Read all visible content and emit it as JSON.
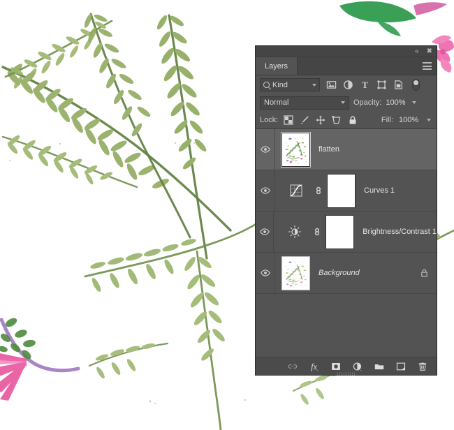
{
  "app": {
    "panel_title": "Layers"
  },
  "titlebar": {
    "collapse_icon": "double-chevron-left-icon",
    "close_icon": "close-icon",
    "menu_icon": "panel-menu-icon"
  },
  "filter": {
    "kind_label": "Kind",
    "search_icon": "search-icon",
    "dropdown_icon": "chevron-down-icon",
    "icons": [
      {
        "name": "filter-pixel-icon",
        "title": "Filter for pixel layers"
      },
      {
        "name": "filter-adjustment-icon",
        "title": "Filter for adjustment layers"
      },
      {
        "name": "filter-type-icon",
        "title": "Filter for type layers",
        "glyph": "T"
      },
      {
        "name": "filter-shape-icon",
        "title": "Filter for shape layers"
      },
      {
        "name": "filter-smart-object-icon",
        "title": "Filter for smart objects"
      }
    ],
    "toggle_name": "filter-enable-toggle"
  },
  "blend": {
    "mode": "Normal",
    "opacity_label": "Opacity:",
    "opacity_value": "100%"
  },
  "lock": {
    "label": "Lock:",
    "fill_label": "Fill:",
    "fill_value": "100%",
    "icons": [
      {
        "name": "lock-transparent-pixels-icon"
      },
      {
        "name": "lock-image-pixels-icon"
      },
      {
        "name": "lock-position-icon"
      },
      {
        "name": "lock-artboard-nesting-icon"
      },
      {
        "name": "lock-all-icon"
      }
    ]
  },
  "layers": [
    {
      "name": "flatten",
      "selected": true,
      "visible": true,
      "type": "pixel",
      "italic": false,
      "locked": false,
      "has_mask": false
    },
    {
      "name": "Curves 1",
      "selected": false,
      "visible": true,
      "type": "adjustment-curves",
      "italic": false,
      "locked": false,
      "has_mask": true
    },
    {
      "name": "Brightness/Contrast 1",
      "selected": false,
      "visible": true,
      "type": "adjustment-brightness-contrast",
      "italic": false,
      "locked": false,
      "has_mask": true
    },
    {
      "name": "Background",
      "selected": false,
      "visible": true,
      "type": "pixel",
      "italic": true,
      "locked": true,
      "has_mask": false
    }
  ],
  "bottom_toolbar": [
    {
      "name": "link-layers-button",
      "title": "Link layers"
    },
    {
      "name": "layer-style-fx-button",
      "title": "Add a layer style",
      "glyph": "fx"
    },
    {
      "name": "add-layer-mask-button",
      "title": "Add layer mask"
    },
    {
      "name": "new-adjustment-layer-button",
      "title": "Create new fill or adjustment layer"
    },
    {
      "name": "new-group-button",
      "title": "Create a new group"
    },
    {
      "name": "new-layer-button",
      "title": "Create a new layer"
    },
    {
      "name": "delete-layer-button",
      "title": "Delete layer"
    }
  ],
  "colors": {
    "panel_bg": "#535353",
    "panel_header": "#454545",
    "selected_row": "#646464",
    "toolbar_bg": "#4b4b4b",
    "text": "#e0e0e0",
    "canvas_bg": "#ffffff",
    "leaf_green_light": "#a3bd75",
    "leaf_green_mid": "#8aa85c",
    "leaf_green_dark": "#5f8040",
    "leaf_green_deep": "#2f9b4e",
    "flower_pink": "#e8509a",
    "flower_magenta": "#f06ab0",
    "stem_purple": "#9a6fbc"
  }
}
